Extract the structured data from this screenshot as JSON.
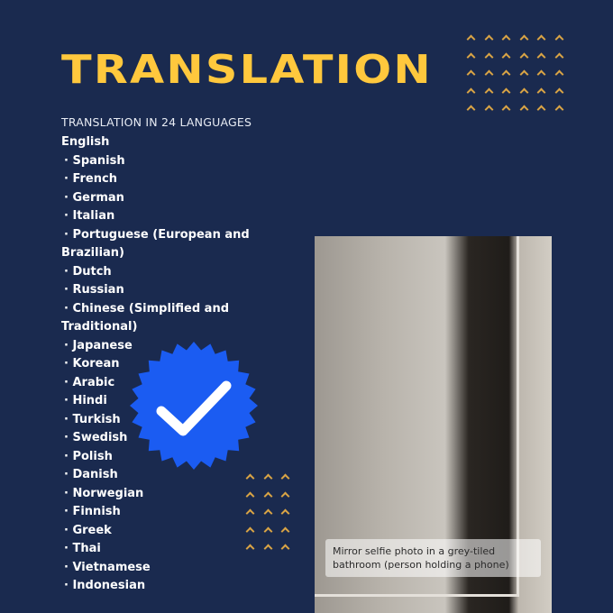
{
  "header": {
    "title": "TRANSLATION",
    "subtitle": "TRANSLATION IN 24 LANGUAGES"
  },
  "languages": {
    "primary": "English",
    "items": [
      "Spanish",
      "French",
      "German",
      "Italian",
      "Portuguese (European and Brazilian)",
      "Dutch",
      "Russian",
      "Chinese (Simplified and Traditional)",
      "Japanese",
      "Korean",
      "Arabic",
      "Hindi",
      "Turkish",
      "Swedish",
      "Polish",
      "Danish",
      "Norwegian",
      "Finnish",
      "Greek",
      "Thai",
      "Vietnamese",
      "Indonesian"
    ]
  },
  "badge": {
    "icon": "verified-check-icon",
    "color": "#1b5cf2"
  },
  "decorations": {
    "icon": "chevron-up-icon",
    "color": "#d9a445"
  },
  "photo": {
    "description": "Mirror selfie photo in a grey-tiled bathroom (person holding a phone)"
  },
  "colors": {
    "background": "#1a2a4f",
    "title": "#ffc83d",
    "text": "#ffffff"
  }
}
